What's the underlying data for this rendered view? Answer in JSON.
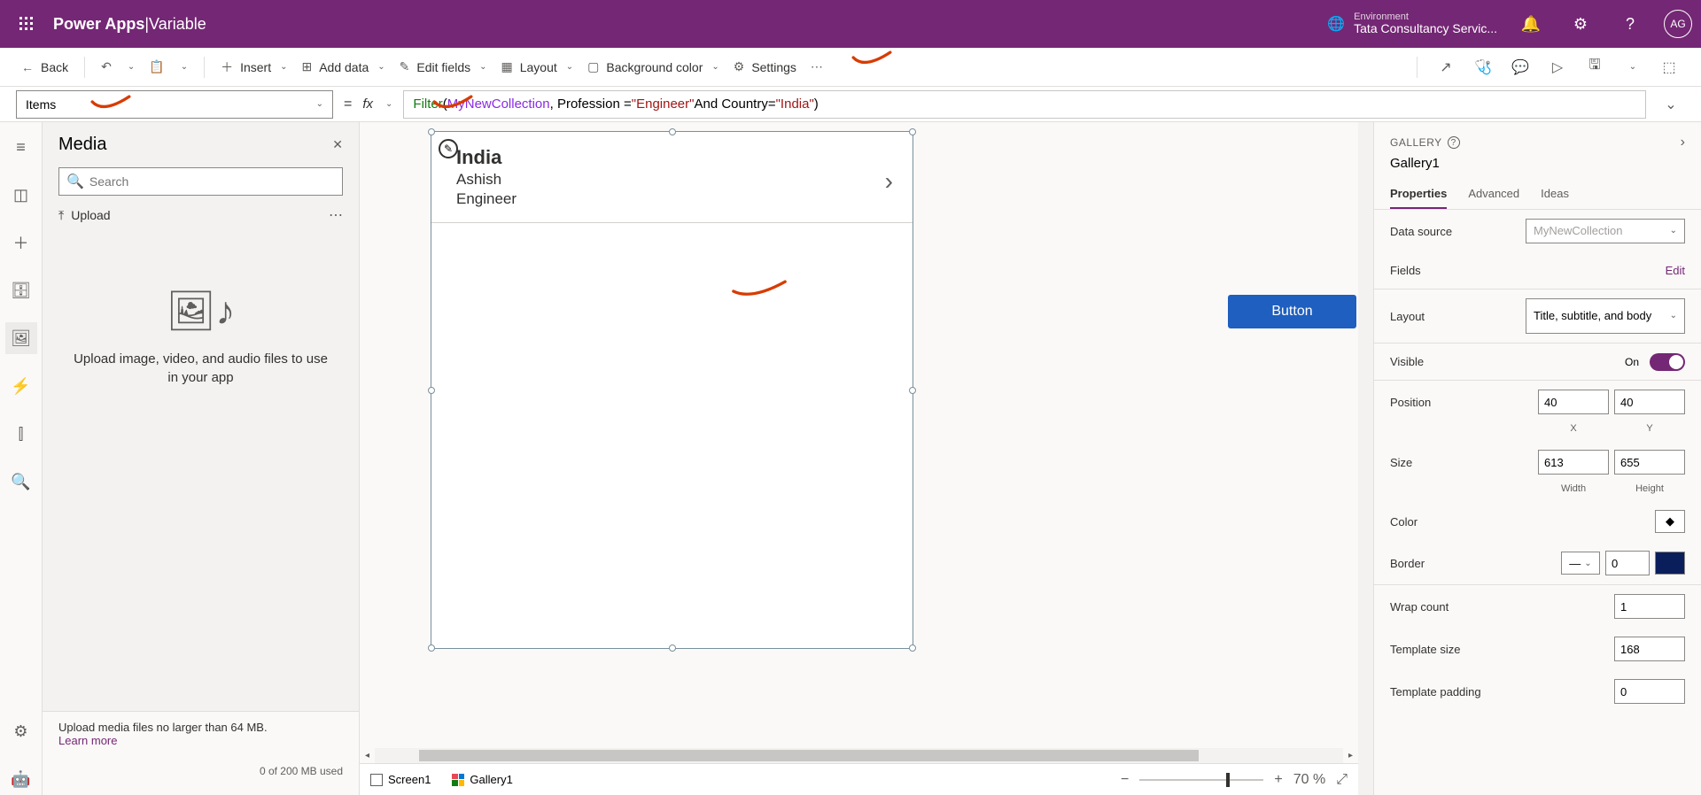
{
  "header": {
    "app_name": "Power Apps",
    "separator": " | ",
    "page_name": "Variable",
    "env_label": "Environment",
    "env_value": "Tata Consultancy Servic...",
    "avatar": "AG"
  },
  "cmdbar": {
    "back": "Back",
    "insert": "Insert",
    "add_data": "Add data",
    "edit_fields": "Edit fields",
    "layout": "Layout",
    "bg_color": "Background color",
    "settings": "Settings"
  },
  "formula": {
    "property": "Items",
    "fx": "fx",
    "parts": {
      "fn": "Filter",
      "open": "(",
      "coll": "MyNewCollection",
      "mid1": ", Profession = ",
      "str1": "\"Engineer\"",
      "mid2": " And Country=",
      "str2": "\"India\"",
      "close": ")"
    }
  },
  "media": {
    "title": "Media",
    "search_placeholder": "Search",
    "upload": "Upload",
    "hint": "Upload image, video, and audio files to use in your app",
    "footer_text": "Upload media files no larger than 64 MB.",
    "learn_more": "Learn more",
    "quota": "0 of 200 MB used"
  },
  "canvas": {
    "gallery_item": {
      "title": "India",
      "subtitle": "Ashish",
      "body": "Engineer"
    },
    "button_label": "Button",
    "breadcrumb": {
      "screen": "Screen1",
      "gallery": "Gallery1"
    },
    "zoom": "70  %"
  },
  "props": {
    "header": "GALLERY",
    "name": "Gallery1",
    "tabs": {
      "properties": "Properties",
      "advanced": "Advanced",
      "ideas": "Ideas"
    },
    "data_source_label": "Data source",
    "data_source_value": "MyNewCollection",
    "fields_label": "Fields",
    "fields_edit": "Edit",
    "layout_label": "Layout",
    "layout_value": "Title, subtitle, and body",
    "visible_label": "Visible",
    "visible_value": "On",
    "position_label": "Position",
    "position_x": "40",
    "position_y": "40",
    "position_xl": "X",
    "position_yl": "Y",
    "size_label": "Size",
    "size_w": "613",
    "size_h": "655",
    "size_wl": "Width",
    "size_hl": "Height",
    "color_label": "Color",
    "border_label": "Border",
    "border_width": "0",
    "wrap_label": "Wrap count",
    "wrap_value": "1",
    "template_size_label": "Template size",
    "template_size_value": "168",
    "template_padding_label": "Template padding",
    "template_padding_value": "0"
  }
}
